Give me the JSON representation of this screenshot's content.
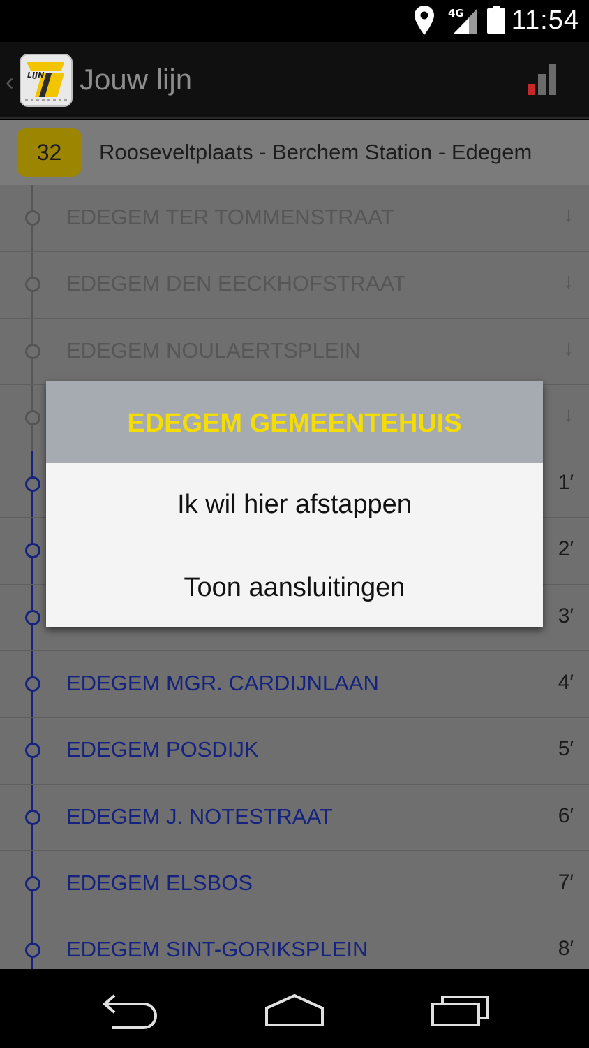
{
  "status_bar": {
    "time": "11:54",
    "network": "4G",
    "icons": [
      "location-pin-icon",
      "signal-4g-icon",
      "battery-icon"
    ]
  },
  "action_bar": {
    "title": "Jouw lijn",
    "logo_text": "LIJN",
    "icons": [
      "back-chevron-icon",
      "de-lijn-logo",
      "signal-strength-icon"
    ]
  },
  "route": {
    "number": "32",
    "name": "Rooseveltplaats - Berchem Station - Edegem",
    "badge_color": "#9c8500"
  },
  "stops": [
    {
      "name": "EDEGEM TER TOMMENSTRAAT",
      "state": "passed",
      "indicator": "↓"
    },
    {
      "name": "EDEGEM DEN EECKHOFSTRAAT",
      "state": "passed",
      "indicator": "↓"
    },
    {
      "name": "EDEGEM NOULAERTSPLEIN",
      "state": "passed",
      "indicator": "↓"
    },
    {
      "name": "",
      "state": "passed",
      "indicator": "↓"
    },
    {
      "name": "",
      "state": "upcoming",
      "indicator": "1′"
    },
    {
      "name": "",
      "state": "upcoming",
      "indicator": "2′"
    },
    {
      "name": "",
      "state": "upcoming",
      "indicator": "3′"
    },
    {
      "name": "EDEGEM MGR. CARDIJNLAAN",
      "state": "upcoming",
      "indicator": "4′"
    },
    {
      "name": "EDEGEM POSDIJK",
      "state": "upcoming",
      "indicator": "5′"
    },
    {
      "name": "EDEGEM J. NOTESTRAAT",
      "state": "upcoming",
      "indicator": "6′"
    },
    {
      "name": "EDEGEM ELSBOS",
      "state": "upcoming",
      "indicator": "7′"
    },
    {
      "name": "EDEGEM SINT-GORIKSPLEIN",
      "state": "upcoming",
      "indicator": "8′"
    }
  ],
  "dialog": {
    "title": "EDEGEM GEMEENTEHUIS",
    "options": [
      "Ik wil hier afstappen",
      "Toon aansluitingen"
    ],
    "title_color": "#f5dd00"
  },
  "colors": {
    "upcoming_stop": "#15237e",
    "passed_stop": "#565656",
    "signal_red": "#c62828"
  },
  "nav_bar": {
    "icons": [
      "back-icon",
      "home-icon",
      "recent-apps-icon"
    ]
  }
}
